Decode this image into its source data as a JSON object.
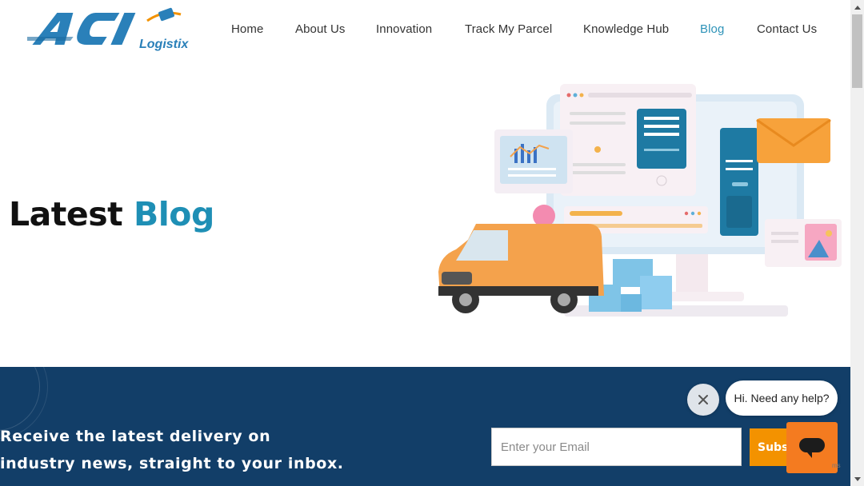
{
  "brand": {
    "logo_big": "ACI",
    "logo_small": "Logistix"
  },
  "nav": {
    "items": [
      {
        "label": "Home"
      },
      {
        "label": "About Us"
      },
      {
        "label": "Innovation"
      },
      {
        "label": "Track My Parcel"
      },
      {
        "label": "Knowledge Hub"
      },
      {
        "label": "Blog",
        "active": true
      },
      {
        "label": "Contact Us"
      }
    ]
  },
  "hero": {
    "title_part1": "Latest",
    "title_part2": "Blog"
  },
  "newsletter": {
    "text": "Receive the latest delivery on industry news, straight to your inbox.",
    "email_placeholder": "Enter your Email",
    "subscribe_label": "Subscribe"
  },
  "chat": {
    "greeting": "Hi. Need any help?",
    "close_icon": "close-icon",
    "launcher_icon": "chat-icon"
  },
  "recaptcha": {
    "peek": "ms"
  },
  "colors": {
    "accent": "#1e8fb5",
    "band": "#123e68",
    "orange": "#f39200",
    "chat_orange": "#f47b20"
  }
}
